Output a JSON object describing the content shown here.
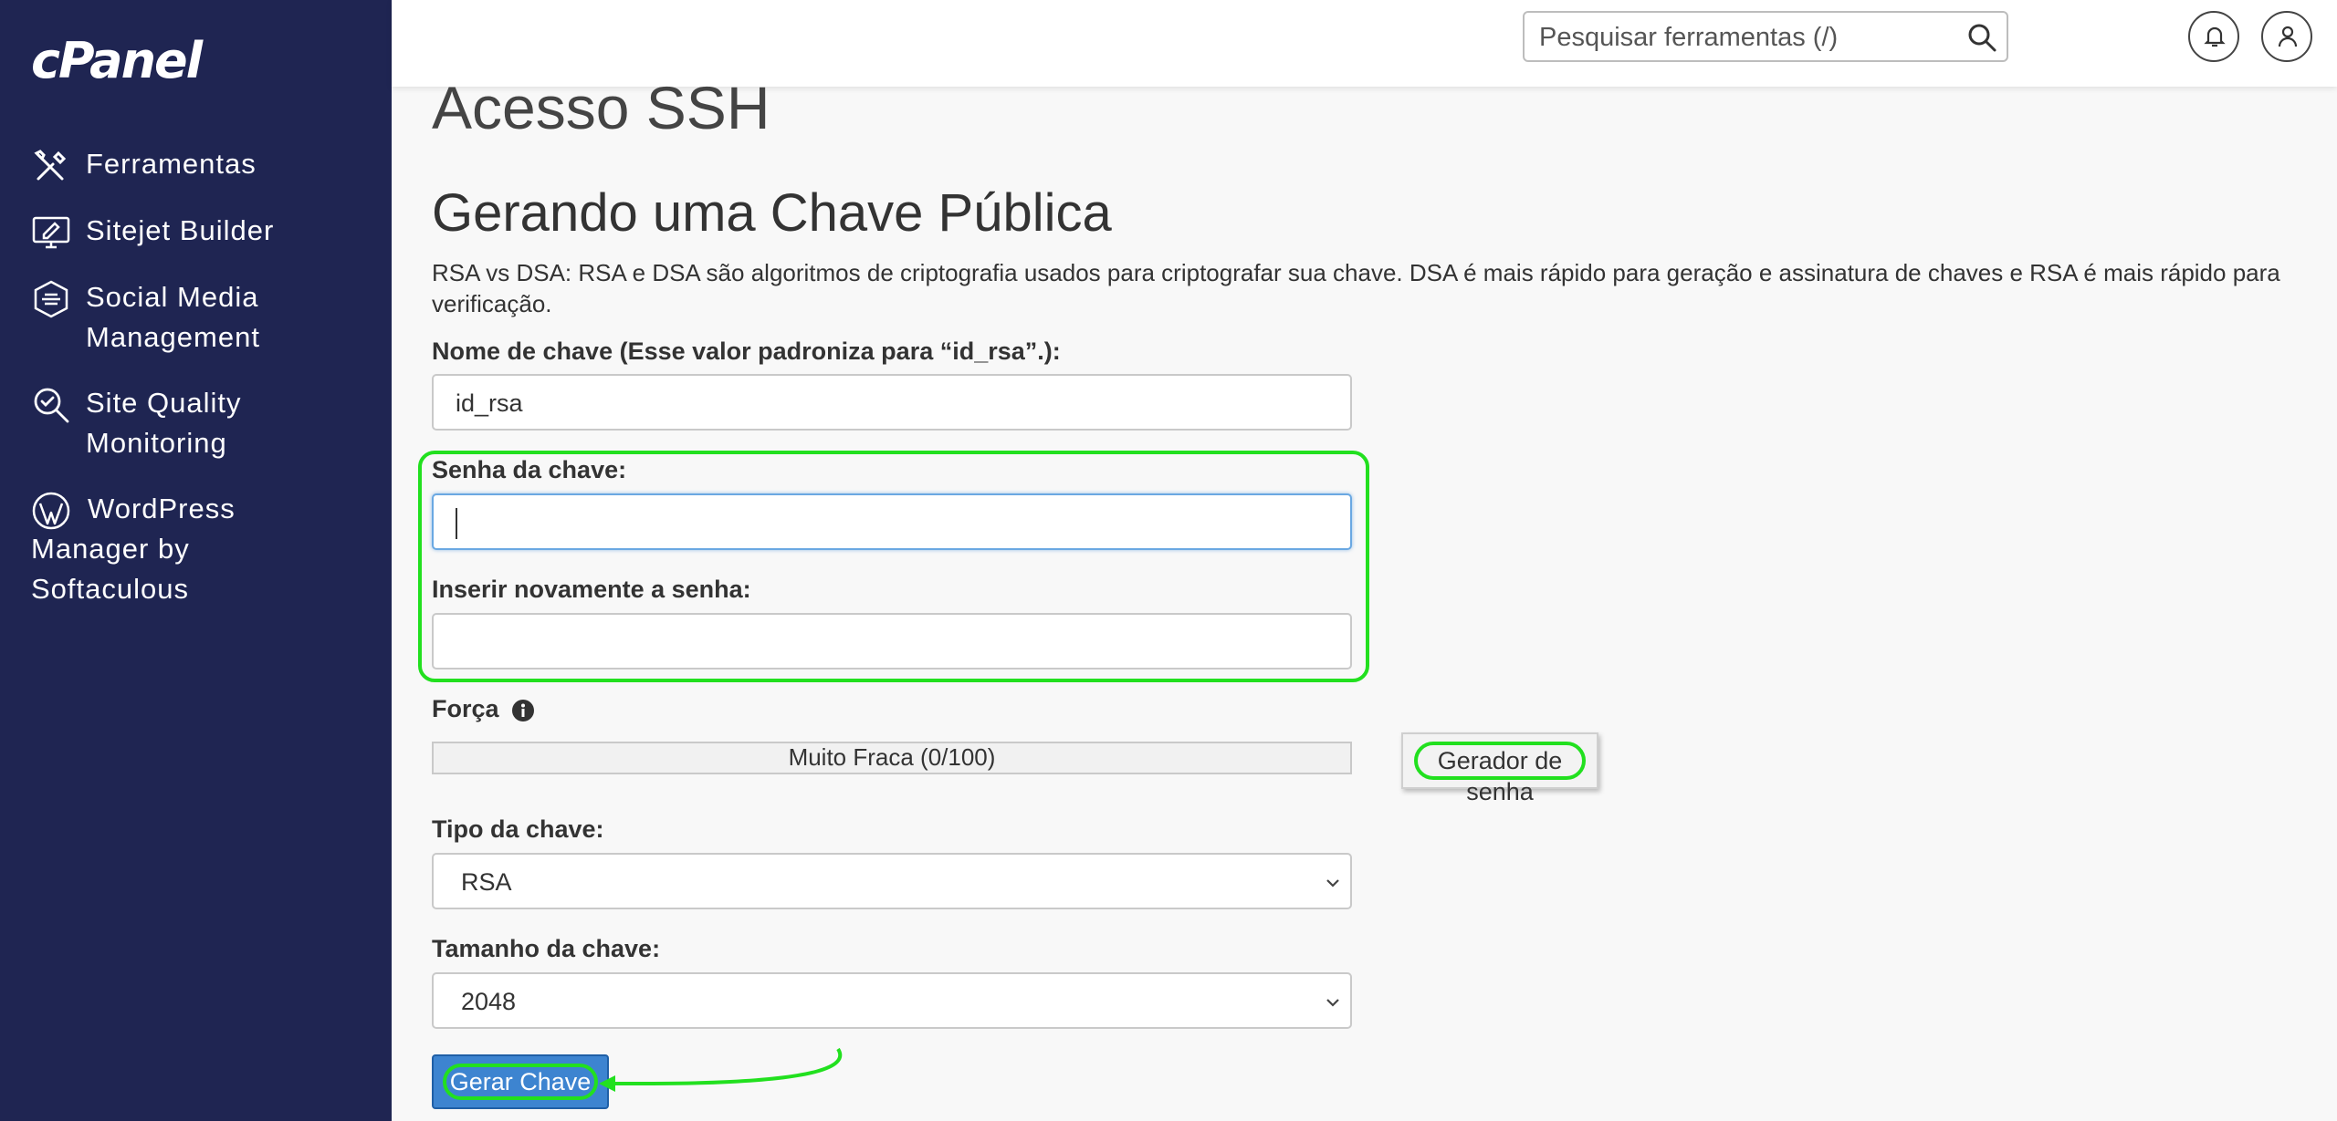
{
  "sidebar": {
    "logo": "cPanel",
    "items": [
      {
        "label": "Ferramentas",
        "icon": "tools-icon"
      },
      {
        "label": "Sitejet Builder",
        "icon": "monitor-edit-icon"
      },
      {
        "label": "Social Media\nManagement",
        "icon": "social-hexagon-icon"
      },
      {
        "label": "Site Quality\nMonitoring",
        "icon": "magnifier-check-icon"
      },
      {
        "label": "WordPress\nManager by\nSoftaculous",
        "icon": "wordpress-icon"
      }
    ]
  },
  "topbar": {
    "search_placeholder": "Pesquisar ferramentas (/)",
    "icons": [
      "search-icon",
      "bell-icon",
      "user-icon"
    ]
  },
  "page": {
    "title": "Acesso SSH",
    "section_title": "Gerando uma Chave Pública",
    "description": "RSA vs DSA: RSA e DSA são algoritmos de criptografia usados para criptografar sua chave. DSA é mais rápido para geração e assinatura de chaves e RSA é mais rápido para verificação."
  },
  "form": {
    "key_name_label": "Nome de chave (Esse valor padroniza para “id_rsa”.):",
    "key_name_value": "id_rsa",
    "password_label": "Senha da chave:",
    "password_value": "",
    "password_confirm_label": "Inserir novamente a senha:",
    "password_confirm_value": "",
    "strength_label": "Força",
    "strength_text": "Muito Fraca (0/100)",
    "strength_value": 0,
    "password_generator_button": "Gerador de senha",
    "key_type_label": "Tipo da chave:",
    "key_type_value": "RSA",
    "key_size_label": "Tamanho da chave:",
    "key_size_value": "2048",
    "submit_button": "Gerar Chave"
  },
  "colors": {
    "sidebar_bg": "#1f2552",
    "annotation_green": "#22e01f",
    "primary_button": "#3d84d0"
  }
}
